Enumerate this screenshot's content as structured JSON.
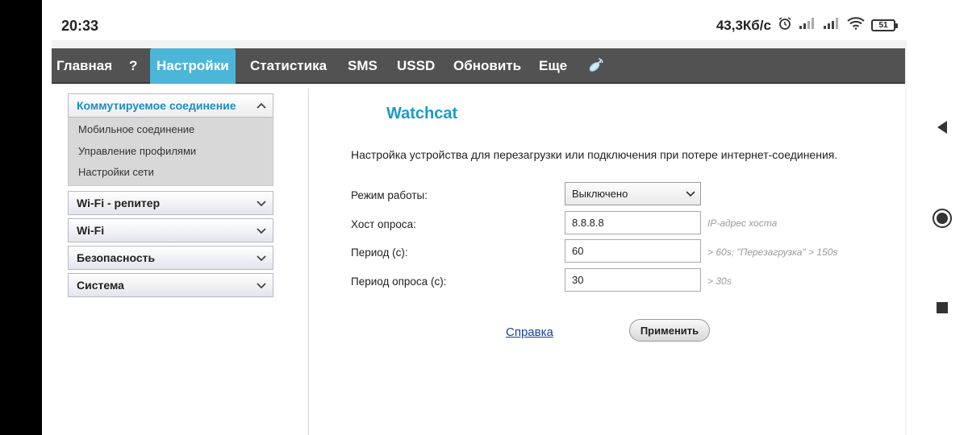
{
  "status_bar": {
    "time": "20:33",
    "net_speed": "43,3Кб/с",
    "battery": "51"
  },
  "topnav": {
    "items": [
      "Главная",
      "?",
      "Настройки",
      "Статистика",
      "SMS",
      "USSD",
      "Обновить",
      "Еще"
    ],
    "active": "Настройки"
  },
  "sidebar": {
    "open_section": {
      "title": "Коммутируемое соединение",
      "items": [
        "Мобильное соединение",
        "Управление профилями",
        "Настройки сети"
      ]
    },
    "sections": [
      "Wi-Fi - репитер",
      "Wi-Fi",
      "Безопасность",
      "Система"
    ]
  },
  "main": {
    "title": "Watchcat",
    "description": "Настройка устройства для перезагрузки или подключения при потере интернет-соединения.",
    "fields": [
      {
        "label": "Режим работы:",
        "value": "Выключено",
        "hint": ""
      },
      {
        "label": "Хост опроса:",
        "value": "8.8.8.8",
        "hint": "IP-адрес хоста"
      },
      {
        "label": "Период (с):",
        "value": "60",
        "hint": "> 60s; \"Перезагрузка\" > 150s"
      },
      {
        "label": "Период опроса (с):",
        "value": "30",
        "hint": "> 30s"
      }
    ],
    "help_link": "Справка",
    "apply_button": "Применить"
  },
  "colors": {
    "accent": "#1a9bc8",
    "nav_bg": "#525252",
    "nav_active": "#4cb6d8"
  }
}
